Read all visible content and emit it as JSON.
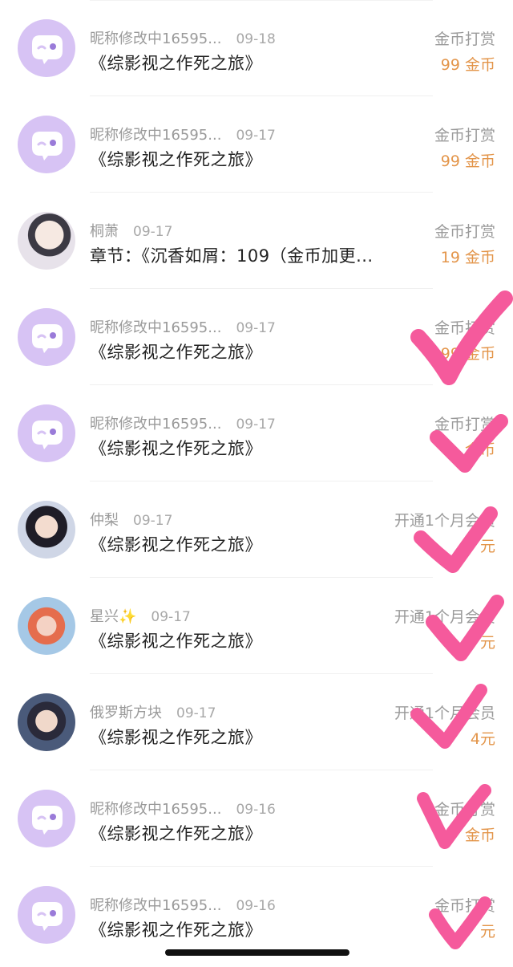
{
  "rows": [
    {
      "avatar": "default-chat-avatar",
      "name": "昵称修改中16595...",
      "date": "09-18",
      "content": "《综影视之作死之旅》",
      "type": "金币打赏",
      "amount": "99 金币"
    },
    {
      "avatar": "default-chat-avatar",
      "name": "昵称修改中16595...",
      "date": "09-17",
      "content": "《综影视之作死之旅》",
      "type": "金币打赏",
      "amount": "99 金币"
    },
    {
      "avatar": "photo-avatar",
      "name": "桐萧",
      "date": "09-17",
      "content": "章节：《沉香如屑：109（金币加更...",
      "type": "金币打赏",
      "amount": "19 金币"
    },
    {
      "avatar": "default-chat-avatar",
      "name": "昵称修改中16595...",
      "date": "09-17",
      "content": "《综影视之作死之旅》",
      "type": "金币打赏",
      "amount": "99 金币"
    },
    {
      "avatar": "default-chat-avatar",
      "name": "昵称修改中16595...",
      "date": "09-17",
      "content": "《综影视之作死之旅》",
      "type": "金币打赏",
      "amount": "金币"
    },
    {
      "avatar": "photo-avatar",
      "name": "仲梨",
      "date": "09-17",
      "content": "《综影视之作死之旅》",
      "type": "开通1个月会员",
      "amount": "元"
    },
    {
      "avatar": "photo-avatar",
      "name": "星兴✨",
      "date": "09-17",
      "content": "《综影视之作死之旅》",
      "type": "开通1个月会员",
      "amount": "元"
    },
    {
      "avatar": "photo-avatar",
      "name": "俄罗斯方块",
      "date": "09-17",
      "content": "《综影视之作死之旅》",
      "type": "开通1个月会员",
      "amount": "4元"
    },
    {
      "avatar": "default-chat-avatar",
      "name": "昵称修改中16595...",
      "date": "09-16",
      "content": "《综影视之作死之旅》",
      "type": "金币打赏",
      "amount": "金币"
    },
    {
      "avatar": "default-chat-avatar",
      "name": "昵称修改中16595...",
      "date": "09-16",
      "content": "《综影视之作死之旅》",
      "type": "金币打赏",
      "amount": "元"
    }
  ],
  "annotation": {
    "icon": "pink-checkmark-icon",
    "color": "#f55a9c"
  },
  "colors": {
    "amount": "#e3954a",
    "avatar_bg": "#d7c3f4",
    "meta": "#9a9a9a"
  }
}
